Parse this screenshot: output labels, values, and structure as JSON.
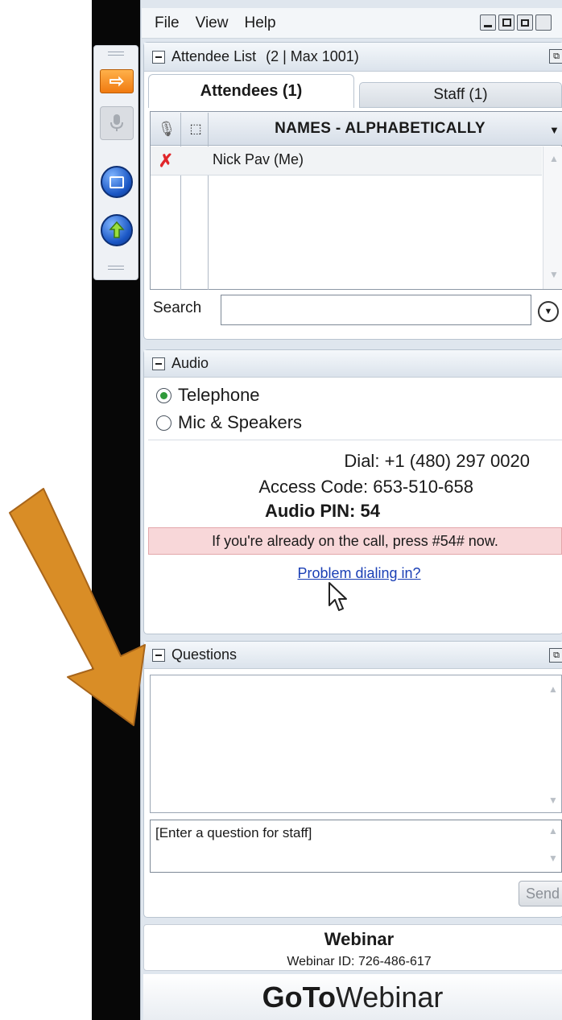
{
  "menu": {
    "items": [
      "File",
      "View",
      "Help"
    ]
  },
  "attendee_list": {
    "title": "Attendee List",
    "count_text": "(2 | Max 1001)",
    "tabs": [
      {
        "label": "Attendees (1)"
      },
      {
        "label": "Staff (1)"
      }
    ],
    "column_header": "NAMES - ALPHABETICALLY",
    "rows": [
      {
        "name": "Nick Pav (Me)"
      }
    ],
    "search_label": "Search",
    "search_value": ""
  },
  "audio": {
    "title": "Audio",
    "options": [
      {
        "label": "Telephone",
        "selected": true
      },
      {
        "label": "Mic & Speakers",
        "selected": false
      }
    ],
    "dial_label": "Dial:",
    "dial_number": "+1 (480) 297 0020",
    "access_label": "Access Code:",
    "access_code": "653-510-658",
    "pin_label": "Audio PIN:",
    "pin": "54",
    "notice": "If you're already on the call, press #54# now.",
    "problem_link": "Problem dialing in?"
  },
  "questions": {
    "title": "Questions",
    "input_placeholder": "[Enter a question for staff]",
    "send_label": "Send"
  },
  "webinar": {
    "title": "Webinar",
    "id_text": "Webinar ID: 726-486-617",
    "brand_bold": "GoTo",
    "brand_rest": "Webinar"
  },
  "colors": {
    "arrow": "#d98d26",
    "notice_bg": "#f8d7d9",
    "link": "#1a3fb5",
    "mute_red": "#e0262a"
  }
}
